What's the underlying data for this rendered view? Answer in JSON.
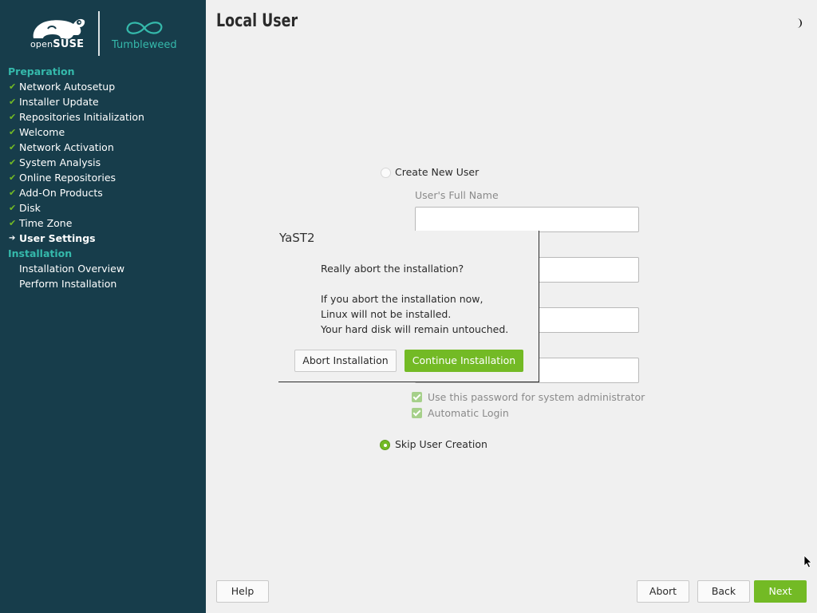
{
  "branding": {
    "opensuse_prefix": "open",
    "opensuse_suffix": "SUSE",
    "distribution": "Tumbleweed",
    "colors": {
      "sidebar_bg": "#173d4b",
      "accent_teal": "#35b9ab",
      "accent_green": "#73ba25"
    }
  },
  "sidebar": {
    "sections": [
      {
        "title": "Preparation",
        "steps": [
          {
            "label": "Network Autosetup",
            "status": "done"
          },
          {
            "label": "Installer Update",
            "status": "done"
          },
          {
            "label": "Repositories Initialization",
            "status": "done"
          },
          {
            "label": "Welcome",
            "status": "done"
          },
          {
            "label": "Network Activation",
            "status": "done"
          },
          {
            "label": "System Analysis",
            "status": "done"
          },
          {
            "label": "Online Repositories",
            "status": "done"
          },
          {
            "label": "Add-On Products",
            "status": "done"
          },
          {
            "label": "Disk",
            "status": "done"
          },
          {
            "label": "Time Zone",
            "status": "done"
          },
          {
            "label": "User Settings",
            "status": "current"
          }
        ]
      },
      {
        "title": "Installation",
        "steps": [
          {
            "label": "Installation Overview",
            "status": "pending"
          },
          {
            "label": "Perform Installation",
            "status": "pending"
          }
        ]
      }
    ]
  },
  "main": {
    "title": "Local User",
    "theme_toggle_icon": "half-moon-icon",
    "create_user_option": {
      "label": "Create New User",
      "selected": false
    },
    "full_name_label": "User's Full Name",
    "full_name_value": "",
    "use_password_for_admin": {
      "label": "Use this password for system administrator",
      "checked": true
    },
    "automatic_login": {
      "label": "Automatic Login",
      "checked": true
    },
    "skip_user_option": {
      "label": "Skip User Creation",
      "selected": true
    }
  },
  "dialog": {
    "title": "YaST2",
    "question": "Really abort the installation?",
    "details": [
      "If you abort the installation now,",
      "Linux will not be installed.",
      "Your hard disk will remain untouched."
    ],
    "abort_label": "Abort Installation",
    "continue_label": "Continue Installation"
  },
  "footer": {
    "help_label": "Help",
    "abort_label": "Abort",
    "back_label": "Back",
    "next_label": "Next"
  }
}
